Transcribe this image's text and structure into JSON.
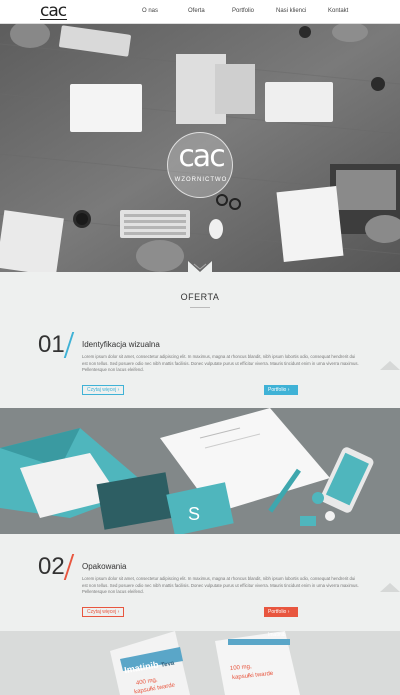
{
  "header": {
    "logo": "cac",
    "nav": [
      "O nas",
      "Oferta",
      "Portfolio",
      "Nasi klienci",
      "Kontakt"
    ]
  },
  "hero": {
    "logo_big": "cac",
    "logo_small": "WZORNICTWO"
  },
  "section": {
    "title": "OFERTA"
  },
  "items": [
    {
      "number": "01",
      "title": "Identyfikacja wizualna",
      "desc": "Lorem ipsum dolor sit amet, consectetur adipiscing elit. In maximus, magna at rhoncus blandit, nibh ipsum lobortis odio, consequat hendrerit dui est non tellus. Sed posuere odio nec nibh mattis facilisis. Donec vulputate purus ut efficitur viverra. Mauris tincidunt enim in urna viverra maximus. Pellentesque non lacus eleifend.",
      "more": "Czytaj więcej",
      "portfolio": "Portfolio",
      "accent": "#3fb2d6"
    },
    {
      "number": "02",
      "title": "Opakowania",
      "desc": "Lorem ipsum dolor sit amet, consectetur adipiscing elit. In maximus, magna at rhoncus blandit, nibh ipsum lobortis odio, consequat hendrerit dui est non tellus. Sed posuere odio nec nibh mattis facilisis. Donec vulputate purus ut efficitur viverra. Mauris tincidunt enim in urna viverra maximus. Pellentesque non lacus eleifend.",
      "more": "Czytaj więcej",
      "portfolio": "Portfolio",
      "accent": "#e8563f"
    }
  ],
  "product": {
    "brand": "Imatinib",
    "brand2": "Teva",
    "dose_left": "400 mg,",
    "form_left": "kapsułki twarde",
    "dose_right": "100 mg,",
    "form_right": "kapsułki twarde",
    "brand_right": "Imatinib"
  }
}
